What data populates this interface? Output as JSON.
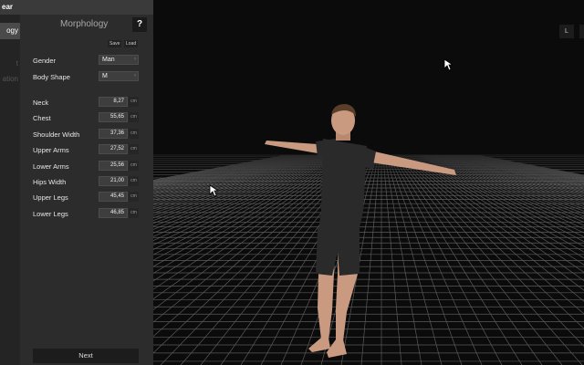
{
  "app": {
    "title_fragment": "ear"
  },
  "sidebar": {
    "active_tab": "ogy",
    "ghost_items": [
      "t",
      "ation"
    ]
  },
  "panel": {
    "title": "Morphology",
    "help_label": "?",
    "save_label": "Save",
    "load_label": "Load",
    "gender": {
      "label": "Gender",
      "value": "Man"
    },
    "body_shape": {
      "label": "Body Shape",
      "value": "M"
    },
    "measurements": [
      {
        "label": "Neck",
        "value": "8,27",
        "unit": "cm"
      },
      {
        "label": "Chest",
        "value": "55,65",
        "unit": "cm"
      },
      {
        "label": "Shoulder Width",
        "value": "37,36",
        "unit": "cm"
      },
      {
        "label": "Upper Arms",
        "value": "27,52",
        "unit": "cm"
      },
      {
        "label": "Lower Arms",
        "value": "25,56",
        "unit": "cm"
      },
      {
        "label": "Hips Width",
        "value": "21,00",
        "unit": "cm"
      },
      {
        "label": "Upper Legs",
        "value": "45,45",
        "unit": "cm"
      },
      {
        "label": "Lower Legs",
        "value": "46,85",
        "unit": "cm"
      }
    ],
    "next_label": "Next"
  },
  "viewport": {
    "view_button": "L"
  },
  "colors": {
    "panel_bg": "#2c2c2c",
    "viewport_bg": "#0b0b0b",
    "grid": "#5a5a5a",
    "suit": "#2a2a2a",
    "skin": "#c99a80"
  }
}
